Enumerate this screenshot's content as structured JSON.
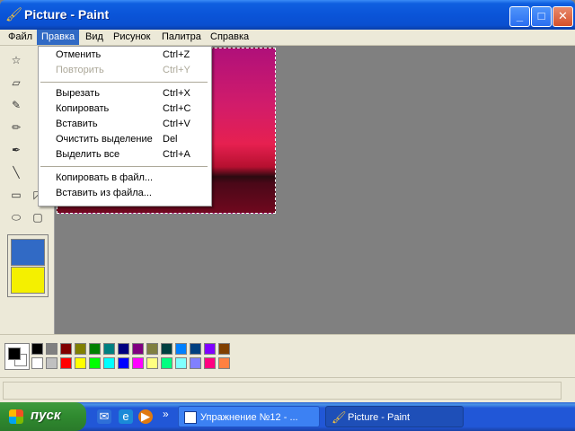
{
  "window": {
    "title": "Picture - Paint"
  },
  "menu": [
    "Файл",
    "Правка",
    "Вид",
    "Рисунок",
    "Палитра",
    "Справка"
  ],
  "dropdown": [
    {
      "label": "Отменить",
      "shortcut": "Ctrl+Z",
      "disabled": false
    },
    {
      "label": "Повторить",
      "shortcut": "Ctrl+Y",
      "disabled": true
    },
    {
      "label": "Вырезать",
      "shortcut": "Ctrl+X",
      "disabled": false
    },
    {
      "label": "Копировать",
      "shortcut": "Ctrl+C",
      "disabled": false
    },
    {
      "label": "Вставить",
      "shortcut": "Ctrl+V",
      "disabled": false
    },
    {
      "label": "Очистить выделение",
      "shortcut": "Del",
      "disabled": false
    },
    {
      "label": "Выделить все",
      "shortcut": "Ctrl+A",
      "disabled": false
    },
    {
      "label": "Копировать в файл...",
      "shortcut": "",
      "disabled": false
    },
    {
      "label": "Вставить из файла...",
      "shortcut": "",
      "disabled": false
    }
  ],
  "palette": {
    "foreground": "#000000",
    "background": "#ffffff",
    "top": [
      "#000000",
      "#808080",
      "#800000",
      "#808000",
      "#008000",
      "#008080",
      "#000080",
      "#800080",
      "#808040",
      "#004040",
      "#0080ff",
      "#004080",
      "#8000ff",
      "#804000"
    ],
    "bottom": [
      "#ffffff",
      "#c0c0c0",
      "#ff0000",
      "#ffff00",
      "#00ff00",
      "#00ffff",
      "#0000ff",
      "#ff00ff",
      "#ffff80",
      "#00ff80",
      "#80ffff",
      "#8080ff",
      "#ff0080",
      "#ff8040"
    ]
  },
  "taskbar": {
    "start_label": "пуск",
    "tasks": [
      {
        "label": "Упражнение №12 - ...",
        "active": false
      },
      {
        "label": "Picture - Paint",
        "active": true
      }
    ],
    "overflow": "»"
  }
}
